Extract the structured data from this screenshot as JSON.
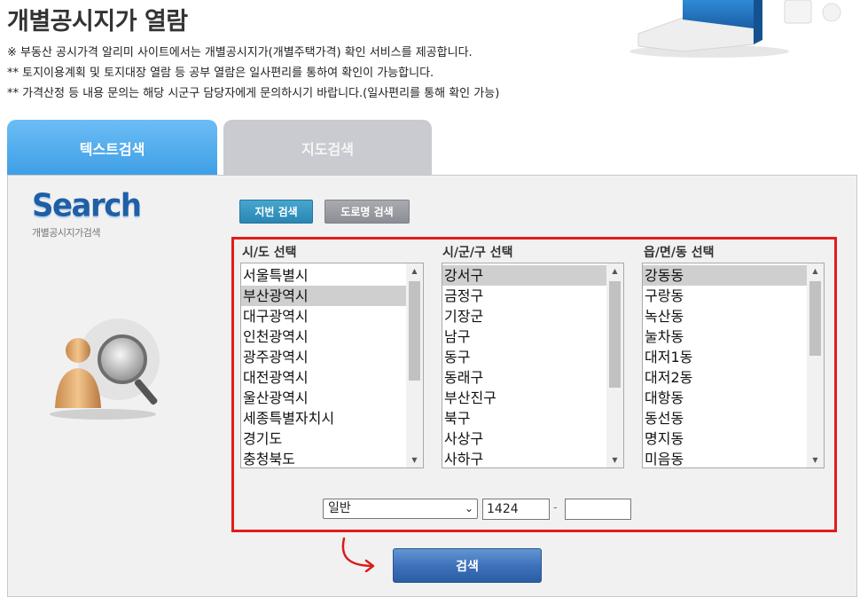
{
  "page": {
    "title": "개별공시지가 열람",
    "notes": [
      "※ 부동산 공시가격 알리미 사이트에서는 개별공시지가(개별주택가격) 확인 서비스를 제공합니다.",
      "** 토지이용계획 및 토지대장 열람 등 공부 열람은 일사편리를 통하여 확인이 가능합니다.",
      "** 가격산정 등 내용 문의는 해당 시군구 담당자에게 문의하시기 바랍니다.(일사편리를 통해 확인 가능)"
    ]
  },
  "tabs": [
    {
      "label": "텍스트검색",
      "active": true
    },
    {
      "label": "지도검색",
      "active": false
    }
  ],
  "logo": {
    "word": "Search",
    "sub": "개별공시지가검색"
  },
  "search_type": {
    "jibeon_label": "지번 검색",
    "road_label": "도로명 검색"
  },
  "columns": [
    {
      "header": "시/도 선택",
      "selected": "부산광역시",
      "items": [
        "서울특별시",
        "부산광역시",
        "대구광역시",
        "인천광역시",
        "광주광역시",
        "대전광역시",
        "울산광역시",
        "세종특별자치시",
        "경기도",
        "충청북도"
      ]
    },
    {
      "header": "시/군/구 선택",
      "selected": "강서구",
      "items": [
        "강서구",
        "금정구",
        "기장군",
        "남구",
        "동구",
        "동래구",
        "부산진구",
        "북구",
        "사상구",
        "사하구"
      ]
    },
    {
      "header": "읍/면/동 선택",
      "selected": "강동동",
      "items": [
        "강동동",
        "구랑동",
        "녹산동",
        "눌차동",
        "대저1동",
        "대저2동",
        "대항동",
        "동선동",
        "명지동",
        "미음동"
      ]
    }
  ],
  "lot": {
    "type_selected": "일반",
    "main_number": "1424",
    "separator": "-",
    "sub_number": ""
  },
  "search_button": "검색",
  "colors": {
    "tab_active": "#4aa8ec",
    "tab_inactive": "#c9cbd0",
    "highlight_box": "#e31b1b",
    "search_button": "#3d72bb",
    "arrow": "#d91c1c"
  }
}
